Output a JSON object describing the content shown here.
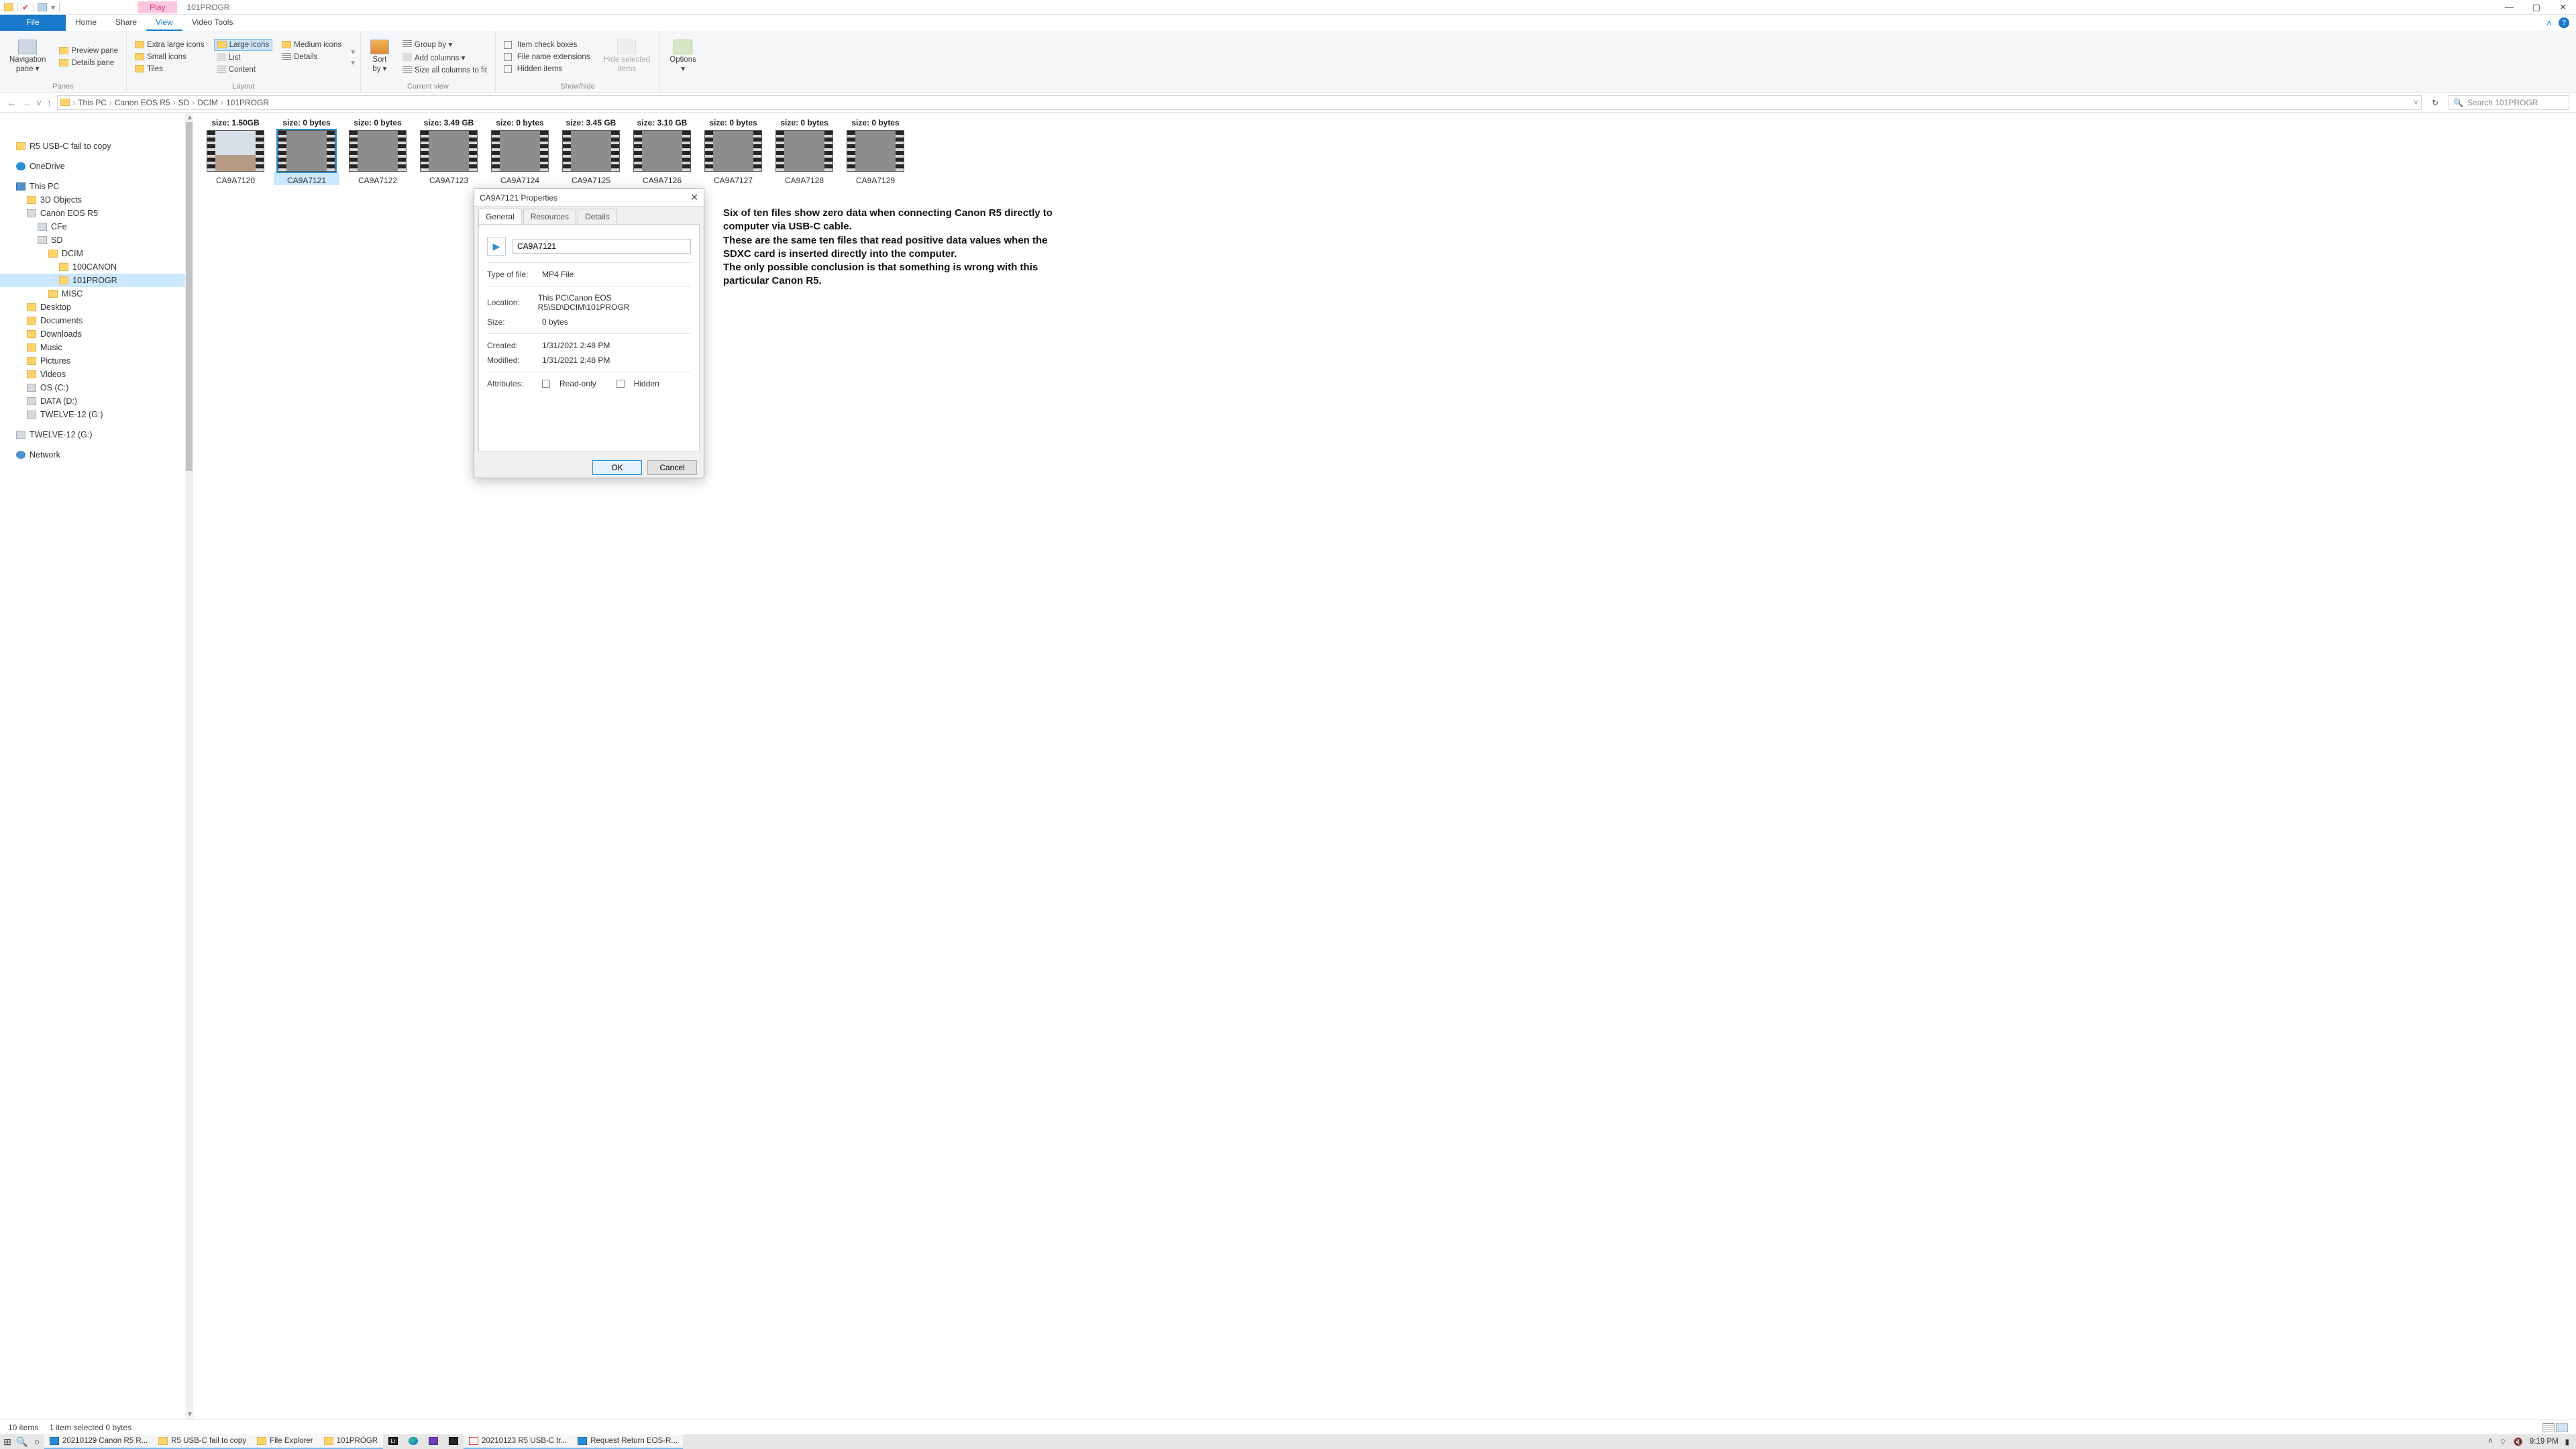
{
  "window": {
    "contextual_tab": "Play",
    "doc_title": "101PROGR",
    "controls": {
      "min": "—",
      "max": "▢",
      "close": "✕"
    }
  },
  "ribbon_tabs": {
    "file": "File",
    "home": "Home",
    "share": "Share",
    "view": "View",
    "video_tools": "Video Tools",
    "collapse": "˄",
    "help": "?"
  },
  "ribbon": {
    "panes": {
      "nav_pane": "Navigation\npane ▾",
      "preview": "Preview pane",
      "details": "Details pane",
      "caption": "Panes"
    },
    "layout": {
      "xl": "Extra large icons",
      "lg": "Large icons",
      "md": "Medium icons",
      "sm": "Small icons",
      "list": "List",
      "details": "Details",
      "tiles": "Tiles",
      "content": "Content",
      "caption": "Layout"
    },
    "current_view": {
      "sort_by": "Sort\nby ▾",
      "group_by": "Group by ▾",
      "add_cols": "Add columns ▾",
      "size_cols": "Size all columns to fit",
      "caption": "Current view"
    },
    "show_hide": {
      "item_check": "Item check boxes",
      "file_ext": "File name extensions",
      "hidden": "Hidden items",
      "hide_sel": "Hide selected\nitems",
      "caption": "Show/hide"
    },
    "options": {
      "options": "Options\n▾"
    }
  },
  "nav": {
    "back": "←",
    "fwd": "→",
    "recent": "˅",
    "up": "↑",
    "crumbs": [
      "This PC",
      "Canon EOS R5",
      "SD",
      "DCIM",
      "101PROGR"
    ],
    "dropdown": "˅",
    "refresh": "↻",
    "search_placeholder": "Search 101PROGR",
    "search_icon": "🔍"
  },
  "sidebar": {
    "items": [
      {
        "indent": 24,
        "icon": "folder",
        "label": "R5 USB-C fail to copy"
      },
      {
        "indent": 24,
        "icon": "cloud",
        "label": "OneDrive",
        "gap_before": 10
      },
      {
        "indent": 24,
        "icon": "pc",
        "label": "This PC",
        "gap_before": 10
      },
      {
        "indent": 40,
        "icon": "folder",
        "label": "3D Objects"
      },
      {
        "indent": 40,
        "icon": "drive",
        "label": "Canon EOS R5"
      },
      {
        "indent": 56,
        "icon": "drive",
        "label": "CFe"
      },
      {
        "indent": 56,
        "icon": "drive",
        "label": "SD"
      },
      {
        "indent": 72,
        "icon": "folder",
        "label": "DCIM"
      },
      {
        "indent": 88,
        "icon": "folder",
        "label": "100CANON"
      },
      {
        "indent": 88,
        "icon": "folder",
        "label": "101PROGR",
        "selected": true
      },
      {
        "indent": 72,
        "icon": "folder",
        "label": "MISC"
      },
      {
        "indent": 40,
        "icon": "folder",
        "label": "Desktop"
      },
      {
        "indent": 40,
        "icon": "folder",
        "label": "Documents"
      },
      {
        "indent": 40,
        "icon": "folder",
        "label": "Downloads"
      },
      {
        "indent": 40,
        "icon": "folder",
        "label": "Music"
      },
      {
        "indent": 40,
        "icon": "folder",
        "label": "Pictures"
      },
      {
        "indent": 40,
        "icon": "folder",
        "label": "Videos"
      },
      {
        "indent": 40,
        "icon": "drive",
        "label": "OS (C:)"
      },
      {
        "indent": 40,
        "icon": "drive",
        "label": "DATA (D:)"
      },
      {
        "indent": 40,
        "icon": "drive",
        "label": "TWELVE-12 (G:)"
      },
      {
        "indent": 24,
        "icon": "drive",
        "label": "TWELVE-12 (G:)",
        "gap_before": 10
      },
      {
        "indent": 24,
        "icon": "net",
        "label": "Network",
        "gap_before": 10
      }
    ]
  },
  "files": [
    {
      "size": "size: 1.50GB",
      "name": "CA9A7120",
      "sky": true
    },
    {
      "size": "size: 0 bytes",
      "name": "CA9A7121",
      "selected": true
    },
    {
      "size": "size: 0 bytes",
      "name": "CA9A7122"
    },
    {
      "size": "size: 3.49 GB",
      "name": "CA9A7123"
    },
    {
      "size": "size: 0 bytes",
      "name": "CA9A7124"
    },
    {
      "size": "size: 3.45 GB",
      "name": "CA9A7125"
    },
    {
      "size": "size: 3.10 GB",
      "name": "CA9A7126"
    },
    {
      "size": "size: 0 bytes",
      "name": "CA9A7127"
    },
    {
      "size": "size: 0 bytes",
      "name": "CA9A7128"
    },
    {
      "size": "size: 0 bytes",
      "name": "CA9A7129"
    }
  ],
  "annotation": {
    "l1": "Six of ten files show zero data when connecting Canon R5 directly to computer via USB-C cable.",
    "l2": "These are the same ten files that read positive data values when the SDXC card is inserted directly into the computer.",
    "l3": "The only possible conclusion is that something is wrong with this particular Canon R5."
  },
  "dialog": {
    "title": "CA9A7121 Properties",
    "close": "✕",
    "tabs": {
      "general": "General",
      "resources": "Resources",
      "details": "Details"
    },
    "filename": "CA9A7121",
    "type_label": "Type of file:",
    "type_value": "MP4 File",
    "loc_label": "Location:",
    "loc_value": "This PC\\Canon EOS R5\\SD\\DCIM\\101PROGR",
    "size_label": "Size:",
    "size_value": "0 bytes",
    "created_label": "Created:",
    "created_value": "1/31/2021 2:48 PM",
    "modified_label": "Modified:",
    "modified_value": "1/31/2021 2:48 PM",
    "attr_label": "Attributes:",
    "readonly": "Read-only",
    "hidden": "Hidden",
    "ok": "OK",
    "cancel": "Cancel",
    "play_glyph": "▶"
  },
  "status": {
    "count": "10 items",
    "selection": "1 item selected  0 bytes"
  },
  "taskbar": {
    "start": "⊞",
    "search": "🔍",
    "cortana": "○",
    "items": [
      {
        "ico": "blue",
        "label": "20210129 Canon R5 R...",
        "active": true
      },
      {
        "ico": "folder",
        "label": "R5 USB-C fail to copy",
        "active": true
      },
      {
        "ico": "folder",
        "label": "File Explorer",
        "active": true
      },
      {
        "ico": "folder",
        "label": "101PROGR",
        "active": true
      },
      {
        "ico": "dark",
        "label": "",
        "glyph": "Lr"
      },
      {
        "ico": "edge",
        "label": ""
      },
      {
        "ico": "purple",
        "label": ""
      },
      {
        "ico": "dark",
        "label": ""
      },
      {
        "ico": "pdf",
        "label": "20210123 R5 USB-C tr...",
        "active": true
      },
      {
        "ico": "blue",
        "label": "Request Return EOS-R...",
        "active": true
      }
    ],
    "tray": {
      "chevron": "˄",
      "wifi": "⌔",
      "vol": "🔇",
      "time": "9:19 PM",
      "notif": "▮"
    }
  }
}
